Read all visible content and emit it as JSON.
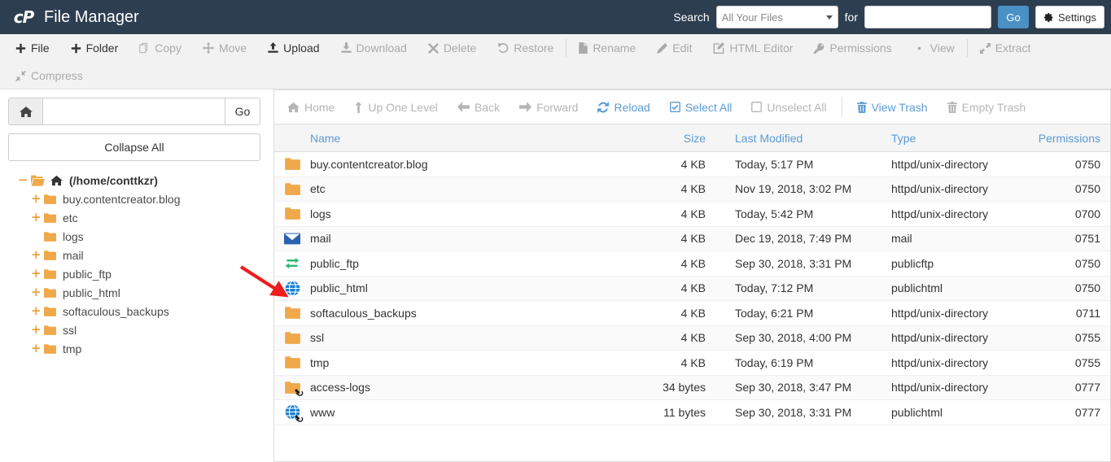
{
  "header": {
    "app_title": "File Manager",
    "logo": "cpanel-logo",
    "search_label": "Search",
    "search_scope_value": "All Your Files",
    "search_for_label": "for",
    "search_query_value": "",
    "search_query_placeholder": "",
    "go_label": "Go",
    "settings_label": "Settings",
    "bg_color": "#2d3e50",
    "go_color": "#4a90c4"
  },
  "toolbar": {
    "row1": [
      {
        "label": "File",
        "icon": "plus-icon",
        "enabled": true
      },
      {
        "label": "Folder",
        "icon": "plus-icon",
        "enabled": true
      },
      {
        "label": "Copy",
        "icon": "copy-icon",
        "enabled": false
      },
      {
        "label": "Move",
        "icon": "move-icon",
        "enabled": false
      },
      {
        "label": "Upload",
        "icon": "upload-icon",
        "enabled": true
      },
      {
        "label": "Download",
        "icon": "download-icon",
        "enabled": false
      },
      {
        "label": "Delete",
        "icon": "x-icon",
        "enabled": false
      },
      {
        "label": "Restore",
        "icon": "restore-icon",
        "enabled": false
      },
      {
        "label": "Rename",
        "icon": "file-icon",
        "enabled": false
      },
      {
        "label": "Edit",
        "icon": "pencil-icon",
        "enabled": false
      },
      {
        "label": "HTML Editor",
        "icon": "html-editor-icon",
        "enabled": false
      },
      {
        "label": "Permissions",
        "icon": "key-icon",
        "enabled": false
      },
      {
        "label": "View",
        "icon": "eye-icon",
        "enabled": false
      },
      {
        "label": "Extract",
        "icon": "extract-icon",
        "enabled": false
      }
    ],
    "row2": [
      {
        "label": "Compress",
        "icon": "compress-icon",
        "enabled": false
      }
    ]
  },
  "sidebar": {
    "home_icon": "home-icon",
    "path_value": "",
    "path_placeholder": "",
    "go_label": "Go",
    "collapse_all_label": "Collapse All",
    "tree": [
      {
        "label": "(/home/conttkzr)",
        "toggle": "−",
        "level": 0,
        "icon": "open-folder-home-icon"
      },
      {
        "label": "buy.contentcreator.blog",
        "toggle": "+",
        "level": 1,
        "icon": "folder-icon"
      },
      {
        "label": "etc",
        "toggle": "+",
        "level": 1,
        "icon": "folder-icon"
      },
      {
        "label": "logs",
        "toggle": "",
        "level": 1,
        "icon": "folder-icon"
      },
      {
        "label": "mail",
        "toggle": "+",
        "level": 1,
        "icon": "folder-icon"
      },
      {
        "label": "public_ftp",
        "toggle": "+",
        "level": 1,
        "icon": "folder-icon"
      },
      {
        "label": "public_html",
        "toggle": "+",
        "level": 1,
        "icon": "folder-icon"
      },
      {
        "label": "softaculous_backups",
        "toggle": "+",
        "level": 1,
        "icon": "folder-icon"
      },
      {
        "label": "ssl",
        "toggle": "+",
        "level": 1,
        "icon": "folder-icon"
      },
      {
        "label": "tmp",
        "toggle": "+",
        "level": 1,
        "icon": "folder-icon"
      }
    ]
  },
  "navbar": [
    {
      "label": "Home",
      "icon": "home-icon",
      "enabled": false
    },
    {
      "label": "Up One Level",
      "icon": "up-arrow-icon",
      "enabled": false
    },
    {
      "label": "Back",
      "icon": "back-arrow-icon",
      "enabled": false
    },
    {
      "label": "Forward",
      "icon": "forward-arrow-icon",
      "enabled": false
    },
    {
      "label": "Reload",
      "icon": "reload-icon",
      "enabled": true
    },
    {
      "label": "Select All",
      "icon": "checked-box-icon",
      "enabled": true
    },
    {
      "label": "Unselect All",
      "icon": "empty-box-icon",
      "enabled": false
    },
    {
      "label": "View Trash",
      "icon": "trash-icon",
      "enabled": true
    },
    {
      "label": "Empty Trash",
      "icon": "trash-icon",
      "enabled": false
    }
  ],
  "table": {
    "columns": [
      "Name",
      "Size",
      "Last Modified",
      "Type",
      "Permissions"
    ],
    "rows": [
      {
        "name": "buy.contentcreator.blog",
        "size": "4 KB",
        "modified": "Today, 5:17 PM",
        "type": "httpd/unix-directory",
        "permissions": "0750",
        "icon": "folder-icon",
        "symlink": false
      },
      {
        "name": "etc",
        "size": "4 KB",
        "modified": "Nov 19, 2018, 3:02 PM",
        "type": "httpd/unix-directory",
        "permissions": "0750",
        "icon": "folder-icon",
        "symlink": false
      },
      {
        "name": "logs",
        "size": "4 KB",
        "modified": "Today, 5:42 PM",
        "type": "httpd/unix-directory",
        "permissions": "0700",
        "icon": "folder-icon",
        "symlink": false
      },
      {
        "name": "mail",
        "size": "4 KB",
        "modified": "Dec 19, 2018, 7:49 PM",
        "type": "mail",
        "permissions": "0751",
        "icon": "mail-icon",
        "symlink": false
      },
      {
        "name": "public_ftp",
        "size": "4 KB",
        "modified": "Sep 30, 2018, 3:31 PM",
        "type": "publicftp",
        "permissions": "0750",
        "icon": "ftp-icon",
        "symlink": false
      },
      {
        "name": "public_html",
        "size": "4 KB",
        "modified": "Today, 7:12 PM",
        "type": "publichtml",
        "permissions": "0750",
        "icon": "globe-icon",
        "symlink": false
      },
      {
        "name": "softaculous_backups",
        "size": "4 KB",
        "modified": "Today, 6:21 PM",
        "type": "httpd/unix-directory",
        "permissions": "0711",
        "icon": "folder-icon",
        "symlink": false
      },
      {
        "name": "ssl",
        "size": "4 KB",
        "modified": "Sep 30, 2018, 4:00 PM",
        "type": "httpd/unix-directory",
        "permissions": "0755",
        "icon": "folder-icon",
        "symlink": false
      },
      {
        "name": "tmp",
        "size": "4 KB",
        "modified": "Today, 6:19 PM",
        "type": "httpd/unix-directory",
        "permissions": "0755",
        "icon": "folder-icon",
        "symlink": false
      },
      {
        "name": "access-logs",
        "size": "34 bytes",
        "modified": "Sep 30, 2018, 3:47 PM",
        "type": "httpd/unix-directory",
        "permissions": "0777",
        "icon": "folder-icon",
        "symlink": true
      },
      {
        "name": "www",
        "size": "11 bytes",
        "modified": "Sep 30, 2018, 3:31 PM",
        "type": "publichtml",
        "permissions": "0777",
        "icon": "globe-icon",
        "symlink": true
      }
    ]
  },
  "annotation": {
    "type": "red-arrow",
    "color": "#ee1c1c",
    "points_to": "public_html"
  }
}
